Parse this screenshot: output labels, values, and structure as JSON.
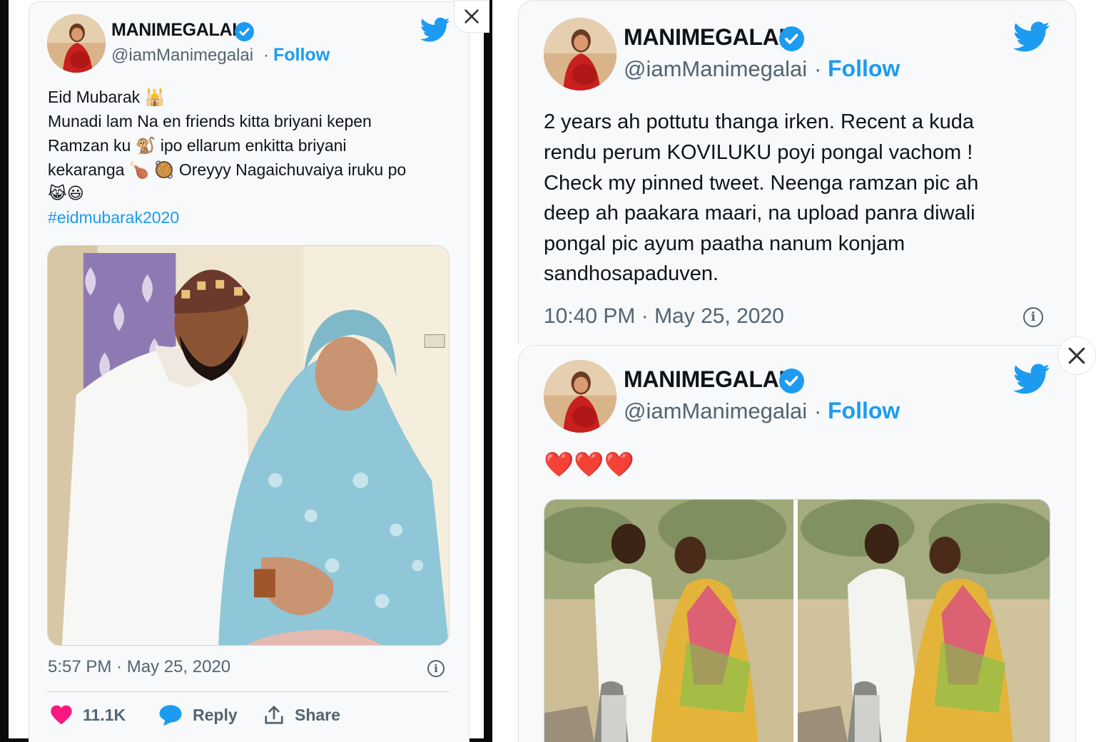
{
  "tweets": [
    {
      "author_name": "MANIMEGALAI",
      "handle": "@iamManimegalai",
      "separator": "·",
      "follow_label": "Follow",
      "text_lines": [
        "Eid Mubarak 🕌",
        "Munadi lam Na en friends kitta briyani kepen",
        "Ramzan ku 🐒 ipo ellarum enkitta briyani",
        "kekaranga 🍗 🥘 Oreyyy Nagaichuvaiya iruku po",
        "😹😃"
      ],
      "hashtag": "#eidmubarak2020",
      "timestamp": "5:57 PM · May 25, 2020",
      "actions": {
        "likes": "11.1K",
        "reply_label": "Reply",
        "share_label": "Share"
      }
    },
    {
      "author_name": "MANIMEGALAI",
      "handle": "@iamManimegalai",
      "separator": "·",
      "follow_label": "Follow",
      "text_lines": [
        "2 years ah pottutu thanga irken. Recent a kuda",
        "rendu perum KOVILUKU poyi pongal vachom !",
        "Check my pinned tweet. Neenga ramzan pic ah",
        "deep ah paakara maari, na upload panra diwali",
        "pongal pic ayum paatha nanum konjam",
        "sandhosapaduven."
      ],
      "timestamp": "10:40 PM · May 25, 2020"
    },
    {
      "author_name": "MANIMEGALAI",
      "handle": "@iamManimegalai",
      "separator": "·",
      "follow_label": "Follow",
      "text": "❤️❤️❤️"
    }
  ],
  "colors": {
    "twitter_blue": "#1d9bf0",
    "text": "#0f1419",
    "muted": "#536471",
    "like_pink": "#f91880"
  },
  "icons": [
    "close-icon",
    "twitter-bird-icon",
    "verified-badge-icon",
    "info-icon",
    "heart-icon",
    "reply-bubble-icon",
    "share-icon"
  ]
}
